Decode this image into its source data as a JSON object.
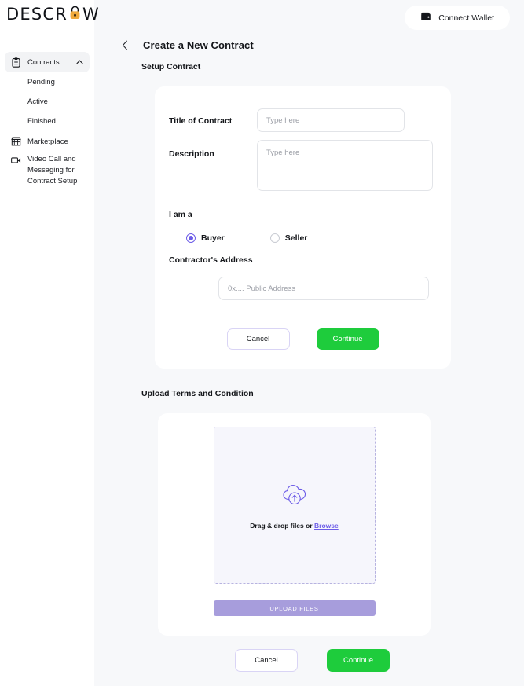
{
  "brand": {
    "wordmark_left": "DESCR",
    "wordmark_right": "W",
    "lock_icon": "padlock-icon",
    "lock_color": "#f0a93b"
  },
  "topbar": {
    "connect_wallet_label": "Connect Wallet",
    "wallet_icon": "wallet-icon"
  },
  "sidebar": {
    "items": [
      {
        "label": "Contracts",
        "icon": "clipboard-icon",
        "chevron": "chevron-up-icon",
        "active": true
      },
      {
        "label": "Pending",
        "icon": "",
        "sub": true
      },
      {
        "label": "Active",
        "icon": "",
        "sub": true
      },
      {
        "label": "Finished",
        "icon": "",
        "sub": true
      },
      {
        "label": "Marketplace",
        "icon": "store-icon"
      },
      {
        "label": "Video Call and Messaging for Contract Setup",
        "icon": "video-camera-icon"
      }
    ]
  },
  "page": {
    "back_icon": "chevron-left-icon",
    "title": "Create a New Contract",
    "section_subtitle": "Setup Contract"
  },
  "form": {
    "title_label": "Title of Contract",
    "title_placeholder": "Type here",
    "title_value": "",
    "description_label": "Description",
    "description_placeholder": "Type here",
    "description_value": "",
    "role_label": "I am a",
    "roles": [
      {
        "label": "Buyer",
        "selected": true
      },
      {
        "label": "Seller",
        "selected": false
      }
    ],
    "address_label": "Contractor's Address",
    "address_placeholder": "0x.... Public Address",
    "address_value": "",
    "cancel_label": "Cancel",
    "continue_label": "Continue"
  },
  "upload": {
    "section_title": "Upload Terms and Condition",
    "dropzone_icon": "cloud-upload-icon",
    "dropzone_text": "Drag & drop files or ",
    "browse_label": "Browse",
    "upload_button_label": "UPLOAD FILES",
    "cancel_label": "Cancel",
    "continue_label": "Continue"
  },
  "colors": {
    "accent_purple": "#6c5ce7",
    "accent_green": "#1ecc3c",
    "upload_button": "#a79ddc",
    "lock_gold": "#f0a93b",
    "page_bg": "#f7f8fa"
  }
}
